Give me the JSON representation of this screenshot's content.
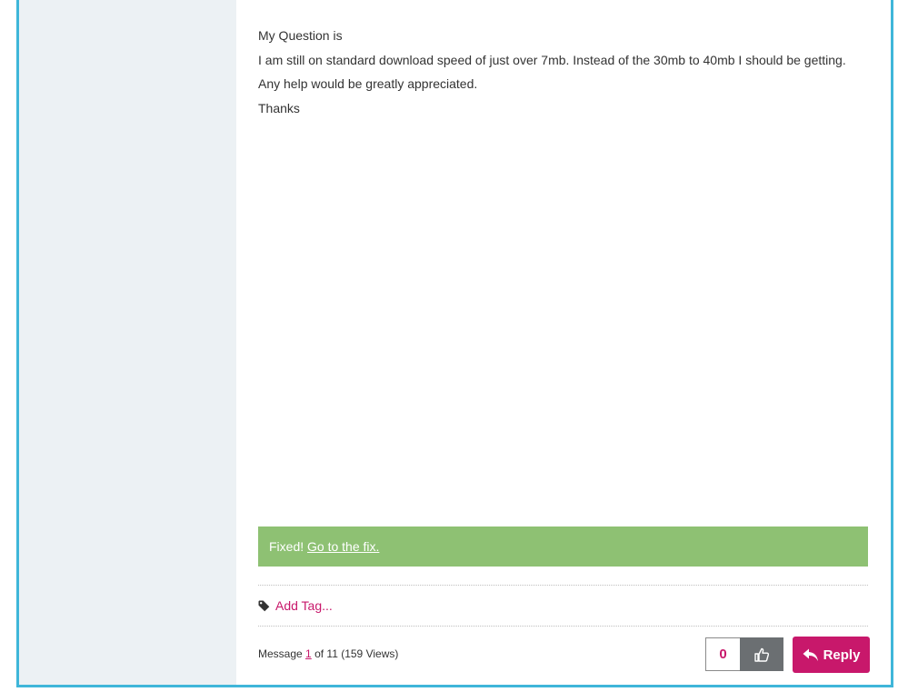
{
  "post": {
    "body": [
      "My Question is",
      "I am still on standard download speed of just over 7mb. Instead of the 30mb to 40mb I should be getting.",
      "Any help would be greatly appreciated.",
      "Thanks"
    ]
  },
  "solution": {
    "prefix": "Fixed!",
    "link": "Go to the fix."
  },
  "tags": {
    "icon": "tag-icon",
    "add_label": "Add Tag..."
  },
  "footer": {
    "message_prefix": "Message",
    "message_number": "1",
    "message_suffix": "of 11 (159 Views)",
    "kudos_count": "0",
    "kudos_icon": "thumbs-up-icon",
    "reply_icon": "reply-arrow-icon",
    "reply_label": "Reply"
  },
  "colors": {
    "frame_border": "#3fb6d9",
    "sidebar_bg": "#ecf1f4",
    "solution_bg": "#8ec173",
    "accent": "#c8186b",
    "kudos_button_bg": "#6b6f72"
  }
}
